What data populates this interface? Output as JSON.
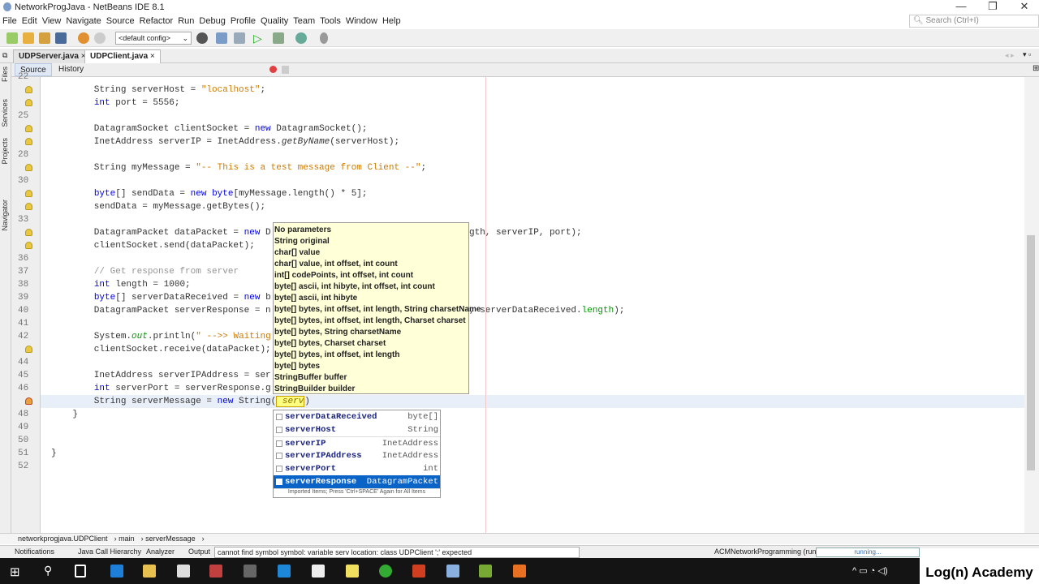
{
  "window": {
    "title": "NetworkProgJava - NetBeans IDE 8.1",
    "minimize": "—",
    "restore": "❐",
    "close": "✕"
  },
  "menu": [
    "File",
    "Edit",
    "View",
    "Navigate",
    "Source",
    "Refactor",
    "Run",
    "Debug",
    "Profile",
    "Quality",
    "Team",
    "Tools",
    "Window",
    "Help"
  ],
  "search": {
    "placeholder": "Search (Ctrl+I)"
  },
  "toolbar": {
    "config": "<default config>"
  },
  "tabs": [
    {
      "label": "UDPServer.java",
      "close": "×"
    },
    {
      "label": "UDPClient.java",
      "close": "×"
    }
  ],
  "editor_tabs": {
    "source": "Source",
    "history": "History"
  },
  "side_labels": [
    "Files",
    "Services",
    "Projects",
    "Navigator"
  ],
  "code": [
    {
      "n": "22",
      "hint": "",
      "segs": []
    },
    {
      "n": "",
      "hint": "hint",
      "segs": [
        [
          "        String serverHost = ",
          ""
        ],
        [
          "\"localhost\"",
          "str"
        ],
        [
          ";",
          ""
        ]
      ]
    },
    {
      "n": "",
      "hint": "hint",
      "segs": [
        [
          "        ",
          ""
        ],
        [
          "int",
          "kw"
        ],
        [
          " port = 5556;",
          ""
        ]
      ]
    },
    {
      "n": "25",
      "hint": "",
      "segs": []
    },
    {
      "n": "",
      "hint": "hint",
      "segs": [
        [
          "        DatagramSocket clientSocket = ",
          ""
        ],
        [
          "new",
          "kw"
        ],
        [
          " DatagramSocket();",
          ""
        ]
      ]
    },
    {
      "n": "",
      "hint": "hint",
      "segs": [
        [
          "        InetAddress serverIP = InetAddress.",
          ""
        ],
        [
          "getByName",
          "it"
        ],
        [
          "(serverHost);",
          ""
        ]
      ]
    },
    {
      "n": "28",
      "hint": "",
      "segs": []
    },
    {
      "n": "",
      "hint": "hint",
      "segs": [
        [
          "        String myMessage = ",
          ""
        ],
        [
          "\"-- This is a test message from Client --\"",
          "str"
        ],
        [
          ";",
          ""
        ]
      ]
    },
    {
      "n": "30",
      "hint": "",
      "segs": []
    },
    {
      "n": "",
      "hint": "hint",
      "segs": [
        [
          "        ",
          ""
        ],
        [
          "byte",
          "kw"
        ],
        [
          "[] sendData = ",
          ""
        ],
        [
          "new",
          "kw"
        ],
        [
          " ",
          ""
        ],
        [
          "byte",
          "kw"
        ],
        [
          "[myMessage.length() * 5];",
          ""
        ]
      ]
    },
    {
      "n": "",
      "hint": "hint",
      "segs": [
        [
          "        sendData = myMessage.getBytes();",
          ""
        ]
      ]
    },
    {
      "n": "33",
      "hint": "",
      "segs": []
    },
    {
      "n": "",
      "hint": "hint",
      "segs": [
        [
          "        DatagramPacket dataPacket = ",
          ""
        ],
        [
          "new",
          "kw"
        ],
        [
          " D",
          ""
        ]
      ],
      "right": [
        [
          "gth, serverIP, port);",
          ""
        ]
      ]
    },
    {
      "n": "",
      "hint": "hint",
      "segs": [
        [
          "        clientSocket.send(dataPacket);",
          ""
        ]
      ]
    },
    {
      "n": "36",
      "hint": "",
      "segs": []
    },
    {
      "n": "37",
      "hint": "",
      "segs": [
        [
          "        ",
          ""
        ],
        [
          "// Get response from server",
          "cm"
        ]
      ]
    },
    {
      "n": "38",
      "hint": "",
      "segs": [
        [
          "        ",
          ""
        ],
        [
          "int",
          "kw"
        ],
        [
          " length = 1000;",
          ""
        ]
      ]
    },
    {
      "n": "39",
      "hint": "",
      "segs": [
        [
          "        ",
          ""
        ],
        [
          "byte",
          "kw"
        ],
        [
          "[] serverDataReceived = ",
          ""
        ],
        [
          "new",
          "kw"
        ],
        [
          " b",
          ""
        ]
      ]
    },
    {
      "n": "40",
      "hint": "",
      "segs": [
        [
          "        DatagramPacket serverResponse = n",
          ""
        ]
      ],
      "right": [
        [
          ", serverDataReceived.",
          ""
        ],
        [
          "length",
          "fld"
        ],
        [
          ");",
          ""
        ]
      ]
    },
    {
      "n": "41",
      "hint": "",
      "segs": []
    },
    {
      "n": "42",
      "hint": "",
      "segs": [
        [
          "        System.",
          ""
        ],
        [
          "out",
          "it fld"
        ],
        [
          ".println(",
          ""
        ],
        [
          "\" -->> Waiting",
          "str"
        ]
      ]
    },
    {
      "n": "",
      "hint": "hint",
      "segs": [
        [
          "        clientSocket.receive(dataPacket);",
          ""
        ]
      ]
    },
    {
      "n": "44",
      "hint": "",
      "segs": []
    },
    {
      "n": "45",
      "hint": "",
      "segs": [
        [
          "        InetAddress serverIPAddress = ser",
          ""
        ]
      ]
    },
    {
      "n": "46",
      "hint": "",
      "segs": [
        [
          "        ",
          ""
        ],
        [
          "int",
          "kw"
        ],
        [
          " serverPort = serverResponse.g",
          ""
        ]
      ]
    },
    {
      "n": "",
      "hint": "err",
      "cur": true,
      "segs": [
        [
          "        String serverMessage = ",
          ""
        ],
        [
          "new",
          "kw"
        ],
        [
          " String(",
          ""
        ],
        [
          " serv",
          "par"
        ],
        [
          ")",
          ""
        ]
      ]
    },
    {
      "n": "48",
      "hint": "",
      "segs": [
        [
          "    }",
          ""
        ]
      ]
    },
    {
      "n": "49",
      "hint": "",
      "segs": []
    },
    {
      "n": "50",
      "hint": "",
      "segs": []
    },
    {
      "n": "51",
      "hint": "",
      "segs": [
        [
          "}",
          ""
        ]
      ]
    },
    {
      "n": "52",
      "hint": "",
      "segs": []
    }
  ],
  "param_popup": [
    [
      [
        "No parameters",
        ""
      ]
    ],
    [
      [
        "String original",
        ""
      ]
    ],
    [
      [
        "char[] value",
        ""
      ]
    ],
    [
      [
        "char[] value, int offset, int count",
        ""
      ]
    ],
    [
      [
        "int[] codePoints, int offset, int count",
        ""
      ]
    ],
    [
      [
        "byte[] ascii, int hibyte, int offset, int count",
        ""
      ]
    ],
    [
      [
        "byte[] ascii, int hibyte",
        ""
      ]
    ],
    [
      [
        "byte[] bytes, int offset, int length, String charsetName",
        ""
      ]
    ],
    [
      [
        "byte[] bytes, int offset, int length, Charset charset",
        ""
      ]
    ],
    [
      [
        "byte[] bytes, String charsetName",
        ""
      ]
    ],
    [
      [
        "byte[] bytes, Charset charset",
        ""
      ]
    ],
    [
      [
        "byte[] bytes, int offset, int length",
        ""
      ]
    ],
    [
      [
        "byte[] bytes",
        ""
      ]
    ],
    [
      [
        "StringBuffer buffer",
        ""
      ]
    ],
    [
      [
        "StringBuilder builder",
        ""
      ]
    ]
  ],
  "completion": {
    "items": [
      {
        "name": "serverDataReceived",
        "type": "byte[]"
      },
      {
        "name": "serverHost",
        "type": "String"
      },
      {
        "name": "serverIP",
        "type": "InetAddress"
      },
      {
        "name": "serverIPAddress",
        "type": "InetAddress"
      },
      {
        "name": "serverPort",
        "type": "int"
      },
      {
        "name": "serverResponse",
        "type": "DatagramPacket",
        "selected": true
      }
    ],
    "footer": "Imported Items; Press 'Ctrl+SPACE' Again for All Items"
  },
  "breadcrumb": [
    "networkprogjava.UDPClient",
    "main",
    "serverMessage"
  ],
  "status": {
    "tabs": [
      "Notifications",
      "Java Call Hierarchy",
      "Analyzer",
      "Output"
    ],
    "message": "cannot find symbol   symbol:   variable serv   location: class UDPClient  ';' expected",
    "run_label": "ACMNetworkProgramming (run)",
    "progress": "running..."
  },
  "branding": {
    "logo": "Log(n) Academy"
  }
}
